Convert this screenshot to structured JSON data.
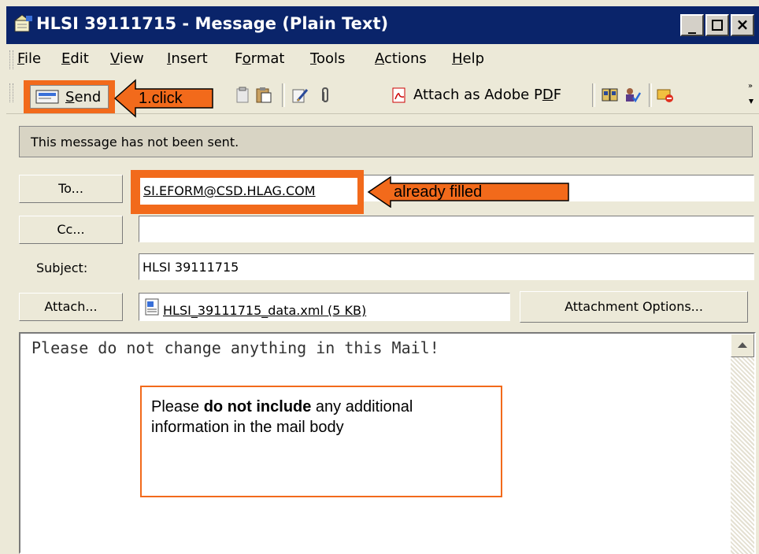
{
  "window": {
    "title": "HLSI 39111715 - Message (Plain Text)",
    "controls": {
      "minimize": "_",
      "maximize": "□",
      "close": "×"
    }
  },
  "menu": {
    "items": [
      {
        "label": "File",
        "hotkey": "F"
      },
      {
        "label": "Edit",
        "hotkey": "E"
      },
      {
        "label": "View",
        "hotkey": "V"
      },
      {
        "label": "Insert",
        "hotkey": "I"
      },
      {
        "label": "Format",
        "hotkey": "o"
      },
      {
        "label": "Tools",
        "hotkey": "T"
      },
      {
        "label": "Actions",
        "hotkey": "A"
      },
      {
        "label": "Help",
        "hotkey": "H"
      }
    ]
  },
  "toolbar": {
    "send_label": "Send",
    "attach_pdf_label": "Attach as Adobe PDF",
    "icons": [
      "send-icon",
      "paste-icon",
      "clipboard-icon",
      "signature-icon",
      "paperclip-icon",
      "pdf-icon",
      "address-book-icon",
      "check-names-icon",
      "options-icon"
    ]
  },
  "info_bar": {
    "text": "This message has not been sent."
  },
  "header": {
    "to_button": "To...",
    "cc_button": "Cc...",
    "subject_label": "Subject:",
    "attach_button": "Attach...",
    "to_value": "SI.EFORM@CSD.HLAG.COM",
    "cc_value": "",
    "subject_value": "HLSI 39111715",
    "attachment_name": "HLSI_39111715_data.xml (5 KB)",
    "attachment_options_button": "Attachment Options..."
  },
  "body": {
    "text": "Please do not change anything in this Mail!"
  },
  "annotations": {
    "click_callout": "1.click",
    "filled_callout": "already filled",
    "note_prefix": "Please ",
    "note_bold": "do not include",
    "note_suffix": " any additional information in the mail body",
    "accent_color": "#f26a1b"
  }
}
